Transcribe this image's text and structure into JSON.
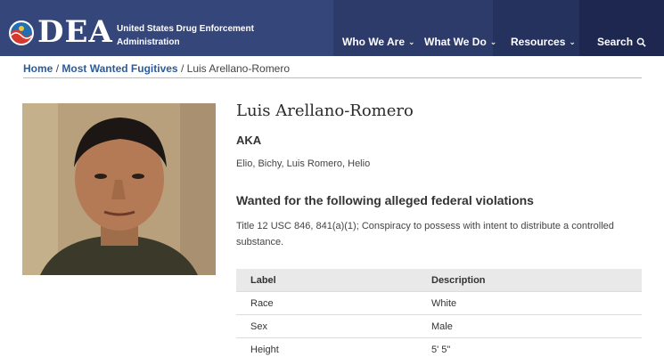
{
  "header": {
    "logo_text": "DEA",
    "agency_line1": "United States Drug Enforcement",
    "agency_line2": "Administration",
    "nav": [
      {
        "label": "Who We Are"
      },
      {
        "label": "What We Do"
      },
      {
        "label": "Resources"
      },
      {
        "label": "Search"
      }
    ]
  },
  "breadcrumb": {
    "home": "Home",
    "section": "Most Wanted Fugitives",
    "current": "Luis Arellano-Romero",
    "separator": "/"
  },
  "profile": {
    "name": "Luis Arellano-Romero",
    "aka_heading": "AKA",
    "aka": "Elio, Bichy, Luis Romero, Helio",
    "wanted_heading": "Wanted for the following alleged federal violations",
    "violations": "Title 12 USC 846, 841(a)(1); Conspiracy to possess with intent to distribute a controlled substance."
  },
  "table": {
    "headers": [
      "Label",
      "Description"
    ],
    "rows": [
      [
        "Race",
        "White"
      ],
      [
        "Sex",
        "Male"
      ],
      [
        "Height",
        "5' 5\""
      ]
    ]
  }
}
